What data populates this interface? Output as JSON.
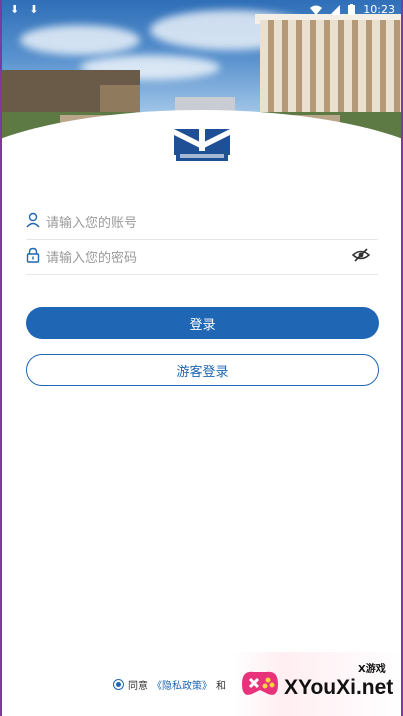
{
  "status_bar": {
    "time": "10:23",
    "download_glyph": "⬇"
  },
  "login": {
    "account_placeholder": "请输入您的账号",
    "password_placeholder": "请输入您的密码",
    "login_button": "登录",
    "guest_button": "游客登录"
  },
  "agreement": {
    "prefix": "同意",
    "policy_link": "《隐私政策》",
    "and": "和"
  },
  "watermark": {
    "small_text": "X游戏",
    "big_text": "XYouXi.net"
  },
  "colors": {
    "primary": "#1f66b4",
    "placeholder": "#9a9a9a"
  }
}
